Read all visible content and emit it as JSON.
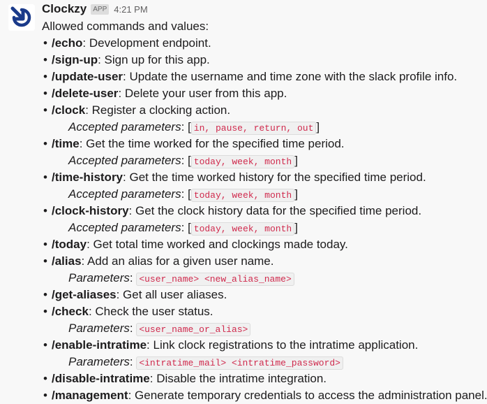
{
  "message": {
    "sender": "Clockzy",
    "badge": "APP",
    "time": "4:21 PM",
    "intro": "Allowed commands and values:",
    "bullet": "•",
    "commands": [
      {
        "name": "/echo",
        "desc": ": Development endpoint."
      },
      {
        "name": "/sign-up",
        "desc": ": Sign up for this app."
      },
      {
        "name": "/update-user",
        "desc": ": Update the username and time zone with the slack profile info."
      },
      {
        "name": "/delete-user",
        "desc": ": Delete your user from this app."
      },
      {
        "name": "/clock",
        "desc": ": Register a clocking action.",
        "param_label": "Accepted parameters",
        "param_sep": ": [",
        "param_code": "in, pause, return, out",
        "param_close": "]"
      },
      {
        "name": "/time",
        "desc": ": Get the time worked for the specified time period.",
        "param_label": "Accepted parameters",
        "param_sep": ": [",
        "param_code": "today, week, month",
        "param_close": "]"
      },
      {
        "name": "/time-history",
        "desc": ": Get the time worked history for the specified time period.",
        "param_label": "Accepted parameters",
        "param_sep": ": [",
        "param_code": "today, week, month",
        "param_close": "]"
      },
      {
        "name": "/clock-history",
        "desc": ": Get the clock history data for the specified time period.",
        "param_label": "Accepted parameters",
        "param_sep": ": [",
        "param_code": "today, week, month",
        "param_close": "]"
      },
      {
        "name": "/today",
        "desc": ": Get total time worked and clockings made today."
      },
      {
        "name": "/alias",
        "desc": ": Add an alias for a given user name.",
        "param_label": "Parameters",
        "param_sep": ": ",
        "param_code": "<user_name> <new_alias_name>",
        "param_close": ""
      },
      {
        "name": "/get-aliases",
        "desc": ": Get all user aliases."
      },
      {
        "name": "/check",
        "desc": ": Check the user status.",
        "param_label": "Parameters",
        "param_sep": ": ",
        "param_code": "<user_name_or_alias>",
        "param_close": ""
      },
      {
        "name": "/enable-intratime",
        "desc": ": Link clock registrations to the intratime application.",
        "param_label": "Parameters",
        "param_sep": ": ",
        "param_code": "<intratime_mail> <intratime_password>",
        "param_close": ""
      },
      {
        "name": "/disable-intratime",
        "desc": ": Disable the intratime integration."
      },
      {
        "name": "/management",
        "desc": ": Generate temporary credentials to access the administration panel."
      }
    ]
  },
  "colors": {
    "background": "#f8f8f8",
    "code_text": "#d02a4d",
    "code_bg": "#f0f0f0",
    "avatar_blue": "#1a3a8a"
  },
  "icons": {
    "avatar": "clockzy-logo-icon"
  }
}
